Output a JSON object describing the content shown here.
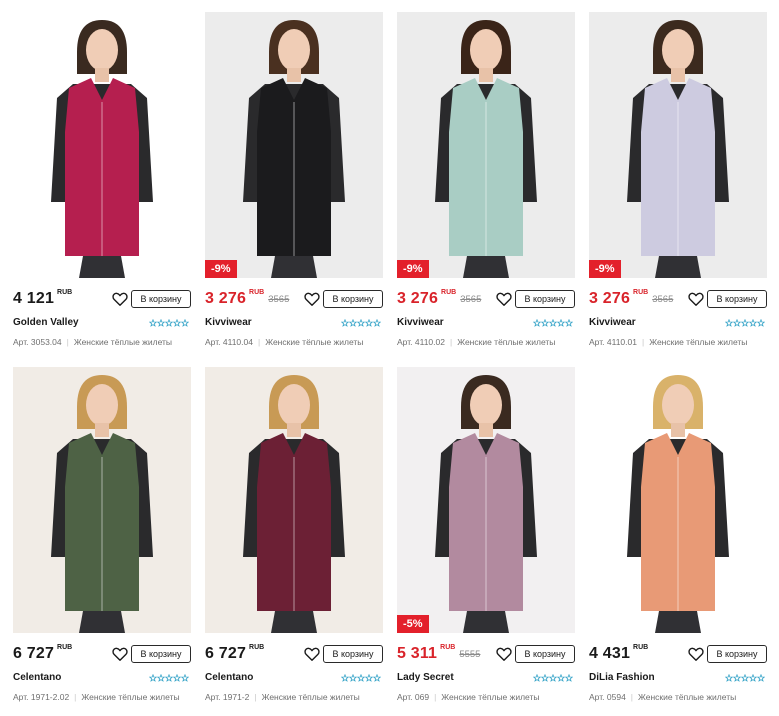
{
  "accent_color": "#d9232a",
  "cart_label": "В корзину",
  "currency_label": "RUB",
  "products": [
    {
      "price": "4 121",
      "old_price": "",
      "discount": "",
      "brand": "Golden Valley",
      "article": "Арт. 3053.04",
      "category": "Женские тёплые жилеты",
      "rating_icon": "stars-empty-icon",
      "garment_color": "#b51f4f",
      "bg_color": "#ffffff"
    },
    {
      "price": "3 276",
      "old_price": "3565",
      "discount": "-9%",
      "brand": "Kivviwear",
      "article": "Арт. 4110.04",
      "category": "Женские тёплые жилеты",
      "rating_icon": "stars-empty-icon",
      "garment_color": "#1b1b1d",
      "bg_color": "#ececec"
    },
    {
      "price": "3 276",
      "old_price": "3565",
      "discount": "-9%",
      "brand": "Kivviwear",
      "article": "Арт. 4110.02",
      "category": "Женские тёплые жилеты",
      "rating_icon": "stars-empty-icon",
      "garment_color": "#a9cdc4",
      "bg_color": "#ececec"
    },
    {
      "price": "3 276",
      "old_price": "3565",
      "discount": "-9%",
      "brand": "Kivviwear",
      "article": "Арт. 4110.01",
      "category": "Женские тёплые жилеты",
      "rating_icon": "stars-empty-icon",
      "garment_color": "#cdcbe0",
      "bg_color": "#ececec"
    },
    {
      "price": "6 727",
      "old_price": "",
      "discount": "",
      "brand": "Celentano",
      "article": "Арт. 1971-2.02",
      "category": "Женские тёплые жилеты",
      "rating_icon": "stars-empty-icon",
      "garment_color": "#4e6245",
      "bg_color": "#f1ece6"
    },
    {
      "price": "6 727",
      "old_price": "",
      "discount": "",
      "brand": "Celentano",
      "article": "Арт. 1971-2",
      "category": "Женские тёплые жилеты",
      "rating_icon": "stars-empty-icon",
      "garment_color": "#6c2035",
      "bg_color": "#f1ece6"
    },
    {
      "price": "5 311",
      "old_price": "5555",
      "discount": "-5%",
      "brand": "Lady Secret",
      "article": "Арт. 069",
      "category": "Женские тёплые жилеты",
      "rating_icon": "stars-empty-icon",
      "garment_color": "#b28a9f",
      "bg_color": "#f2f0f1"
    },
    {
      "price": "4 431",
      "old_price": "",
      "discount": "",
      "brand": "DiLia Fashion",
      "article": "Арт. 0594",
      "category": "Женские тёплые жилеты",
      "rating_icon": "stars-empty-icon",
      "garment_color": "#e89a76",
      "bg_color": "#ffffff"
    }
  ]
}
